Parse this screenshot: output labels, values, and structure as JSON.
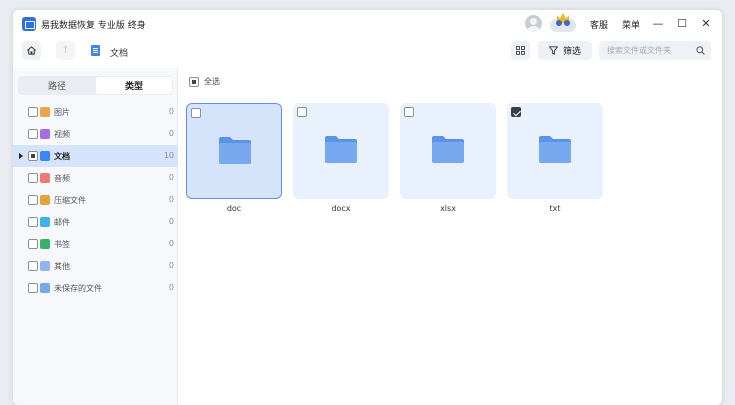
{
  "app": {
    "title": "易我数据恢复 专业版 终身",
    "support_label": "客服",
    "menu_label": "菜单",
    "minimize_glyph": "—",
    "maximize_glyph": "☐",
    "close_glyph": "✕"
  },
  "toolbar": {
    "breadcrumb": "文档",
    "filter_label": "筛选",
    "search_placeholder": "搜索文件或文件夹",
    "search_value": ""
  },
  "sidebar": {
    "tabs": [
      {
        "label": "路径",
        "active": false
      },
      {
        "label": "类型",
        "active": true
      }
    ],
    "categories": [
      {
        "label": "图片",
        "count": "0",
        "icon": "image-icon",
        "color": "#f0a24a"
      },
      {
        "label": "视频",
        "count": "0",
        "icon": "video-icon",
        "color": "#a86de2"
      },
      {
        "label": "文档",
        "count": "10",
        "icon": "document-icon",
        "color": "#3b86f0",
        "selected": true
      },
      {
        "label": "音频",
        "count": "0",
        "icon": "audio-icon",
        "color": "#f07a7a"
      },
      {
        "label": "压缩文件",
        "count": "0",
        "icon": "archive-icon",
        "color": "#e0a53a"
      },
      {
        "label": "邮件",
        "count": "0",
        "icon": "mail-icon",
        "color": "#3db3e8"
      },
      {
        "label": "书签",
        "count": "0",
        "icon": "bookmark-icon",
        "color": "#36b26b"
      },
      {
        "label": "其他",
        "count": "0",
        "icon": "other-icon",
        "color": "#8fb5ee"
      },
      {
        "label": "未保存的文件",
        "count": "0",
        "icon": "unsaved-file-icon",
        "color": "#79a9e8"
      }
    ]
  },
  "main": {
    "select_all_label": "全选",
    "folders": [
      {
        "name": "doc",
        "checked": false,
        "selected": true
      },
      {
        "name": "docx",
        "checked": false,
        "selected": false
      },
      {
        "name": "xlsx",
        "checked": false,
        "selected": false
      },
      {
        "name": "txt",
        "checked": true,
        "selected": false
      }
    ]
  },
  "colors": {
    "accent": "#3b86f0",
    "folder": "#5b93e8",
    "selected_bg": "#d6e4fb"
  }
}
